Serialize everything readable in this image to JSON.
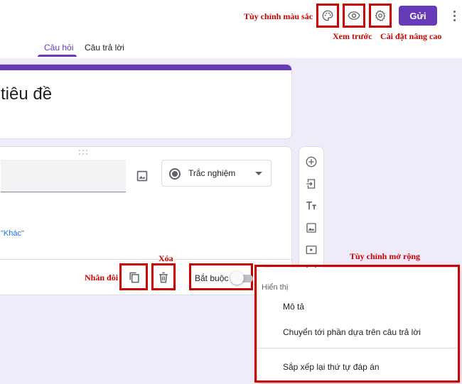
{
  "annotations": {
    "customize_color": "Tùy chỉnh màu sắc",
    "preview": "Xem trước",
    "advanced_settings": "Cài đặt nâng cao",
    "delete": "Xóa",
    "duplicate": "Nhân đôi",
    "extended_options": "Tùy chỉnh mở rộng"
  },
  "header": {
    "send_label": "Gửi",
    "tabs": [
      {
        "label": "Câu hỏi",
        "active": true
      },
      {
        "label": "Câu trả lời",
        "active": false
      }
    ]
  },
  "form": {
    "title_partial": "tiêu đề",
    "question": {
      "type_label": "Trắc nghiệm",
      "other_option_partial": "\"Khác\"",
      "required_label": "Bắt buộc",
      "required_on": false
    }
  },
  "side_toolbar": {
    "icons": [
      "add-question-icon",
      "import-questions-icon",
      "add-title-icon",
      "add-image-icon",
      "add-video-icon",
      "add-section-icon"
    ]
  },
  "more_menu": {
    "header": "Hiển thị",
    "items": [
      "Mô tả",
      "Chuyển tới phần dựa trên câu trả lời",
      "Sắp xếp lại thứ tự đáp án"
    ]
  },
  "colors": {
    "accent": "#673ab7",
    "annotation_red": "#cc0000",
    "background": "#f0ebf8",
    "link_blue": "#1a73e8"
  }
}
